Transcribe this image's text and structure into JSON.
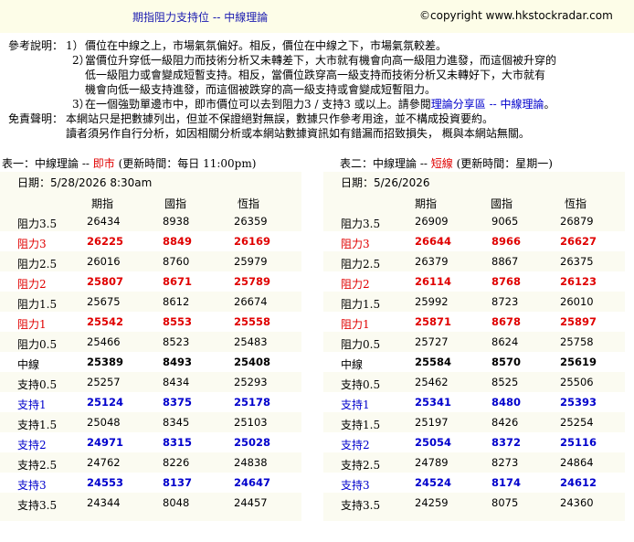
{
  "header": {
    "title": "期指阻力支持位 -- 中線理論",
    "copyright": "©copyright www.hkstockradar.com"
  },
  "notes": {
    "ref_label": "參考說明：",
    "disclaimer_label": "免責聲明：",
    "item1_num": "1）",
    "item1": "價位在中線之上，市場氣氛偏好。相反，價位在中線之下，市場氣氛較差。",
    "item2_num": "2）",
    "item2_l1": "當價位升穿低一級阻力而技術分析又未轉差下，大市就有機會向高一級阻力進發，而這個被升穿的",
    "item2_l2": "低一級阻力或會變成短暫支持。相反，當價位跌穿高一級支持而技術分析又未轉好下，大市就有",
    "item2_l3": "機會向低一級支持進發，而這個被跌穿的高一級支持或會變成短暫阻力。",
    "item3_num": "3）",
    "item3_a": "在一個強勁單邊市中，即市價位可以去到阻力3 / 支持3 或以上。請參閱",
    "item3_link": "理論分享區 -- 中線理論",
    "item3_b": "。",
    "disc_l1": "本網站只是把數據列出，但並不保證絕對無誤，數據只作參考用途，並不構成投資要約。",
    "disc_l2": "讀者須另作自行分析，如因相關分析或本網站數據資訊如有錯漏而招致損失， 概與本網站無關。"
  },
  "table1": {
    "title_a": "表一：中線理論 -- ",
    "title_b": "即市",
    "title_c": " (更新時間：每日 11:00pm)",
    "date": "日期：5/28/2026 8:30am",
    "cols": [
      "期指",
      "國指",
      "恆指"
    ],
    "rows": [
      {
        "label": "阻力3.5",
        "vals": [
          "26434",
          "8938",
          "26359"
        ],
        "style": "plain"
      },
      {
        "label": "阻力3",
        "vals": [
          "26225",
          "8849",
          "26169"
        ],
        "style": "red"
      },
      {
        "label": "阻力2.5",
        "vals": [
          "26016",
          "8760",
          "25979"
        ],
        "style": "plain"
      },
      {
        "label": "阻力2",
        "vals": [
          "25807",
          "8671",
          "25789"
        ],
        "style": "red"
      },
      {
        "label": "阻力1.5",
        "vals": [
          "25675",
          "8612",
          "26674"
        ],
        "style": "plain"
      },
      {
        "label": "阻力1",
        "vals": [
          "25542",
          "8553",
          "25558"
        ],
        "style": "red"
      },
      {
        "label": "阻力0.5",
        "vals": [
          "25466",
          "8523",
          "25483"
        ],
        "style": "plain"
      },
      {
        "label": "中線",
        "vals": [
          "25389",
          "8493",
          "25408"
        ],
        "style": "bold"
      },
      {
        "label": "支持0.5",
        "vals": [
          "25257",
          "8434",
          "25293"
        ],
        "style": "plain"
      },
      {
        "label": "支持1",
        "vals": [
          "25124",
          "8375",
          "25178"
        ],
        "style": "blue"
      },
      {
        "label": "支持1.5",
        "vals": [
          "25048",
          "8345",
          "25103"
        ],
        "style": "plain"
      },
      {
        "label": "支持2",
        "vals": [
          "24971",
          "8315",
          "25028"
        ],
        "style": "blue"
      },
      {
        "label": "支持2.5",
        "vals": [
          "24762",
          "8226",
          "24838"
        ],
        "style": "plain"
      },
      {
        "label": "支持3",
        "vals": [
          "24553",
          "8137",
          "24647"
        ],
        "style": "blue"
      },
      {
        "label": "支持3.5",
        "vals": [
          "24344",
          "8048",
          "24457"
        ],
        "style": "plain"
      }
    ]
  },
  "table2": {
    "title_a": "表二：中線理論 -- ",
    "title_b": "短線",
    "title_c": " (更新時間：星期一)",
    "date": "日期：5/26/2026",
    "cols": [
      "期指",
      "國指",
      "恆指"
    ],
    "rows": [
      {
        "label": "阻力3.5",
        "vals": [
          "26909",
          "9065",
          "26879"
        ],
        "style": "plain"
      },
      {
        "label": "阻力3",
        "vals": [
          "26644",
          "8966",
          "26627"
        ],
        "style": "red"
      },
      {
        "label": "阻力2.5",
        "vals": [
          "26379",
          "8867",
          "26375"
        ],
        "style": "plain"
      },
      {
        "label": "阻力2",
        "vals": [
          "26114",
          "8768",
          "26123"
        ],
        "style": "red"
      },
      {
        "label": "阻力1.5",
        "vals": [
          "25992",
          "8723",
          "26010"
        ],
        "style": "plain"
      },
      {
        "label": "阻力1",
        "vals": [
          "25871",
          "8678",
          "25897"
        ],
        "style": "red"
      },
      {
        "label": "阻力0.5",
        "vals": [
          "25727",
          "8624",
          "25758"
        ],
        "style": "plain"
      },
      {
        "label": "中線",
        "vals": [
          "25584",
          "8570",
          "25619"
        ],
        "style": "bold"
      },
      {
        "label": "支持0.5",
        "vals": [
          "25462",
          "8525",
          "25506"
        ],
        "style": "plain"
      },
      {
        "label": "支持1",
        "vals": [
          "25341",
          "8480",
          "25393"
        ],
        "style": "blue"
      },
      {
        "label": "支持1.5",
        "vals": [
          "25197",
          "8426",
          "25254"
        ],
        "style": "plain"
      },
      {
        "label": "支持2",
        "vals": [
          "25054",
          "8372",
          "25116"
        ],
        "style": "blue"
      },
      {
        "label": "支持2.5",
        "vals": [
          "24789",
          "8273",
          "24864"
        ],
        "style": "plain"
      },
      {
        "label": "支持3",
        "vals": [
          "24524",
          "8174",
          "24612"
        ],
        "style": "blue"
      },
      {
        "label": "支持3.5",
        "vals": [
          "24259",
          "8075",
          "24360"
        ],
        "style": "plain"
      }
    ]
  }
}
